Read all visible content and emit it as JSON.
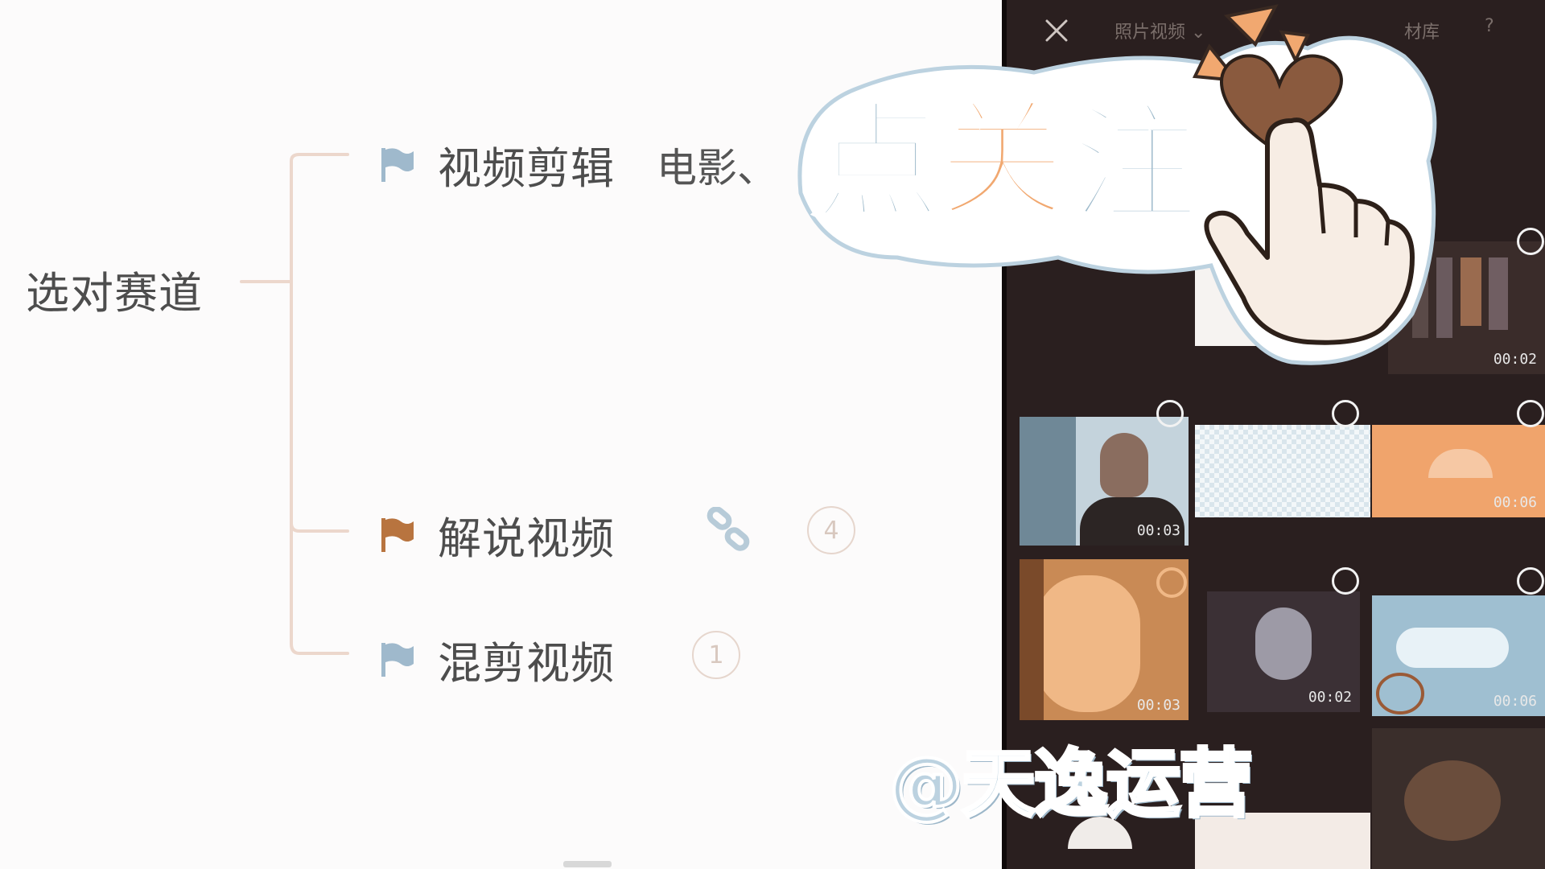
{
  "mindmap": {
    "root": "选对赛道",
    "branches": [
      {
        "label": "视频剪辑",
        "note": "电影、",
        "flag_color": "#9fb9cc"
      },
      {
        "label": "解说视频",
        "badge": "4",
        "flag_color": "#b8743f"
      },
      {
        "label": "混剪视频",
        "badge": "1",
        "flag_color": "#9fb9cc"
      }
    ]
  },
  "panel": {
    "dropdown_label": "照片视频",
    "library_label": "材库",
    "help_label": "?",
    "durations": [
      "00:02",
      "00:03",
      "00:06",
      "00:03",
      "00:02",
      "00:06"
    ]
  },
  "overlay": {
    "sticker_text_1": "点",
    "sticker_text_2": "关",
    "sticker_text_3": "注",
    "watermark": "@天逸运营"
  },
  "colors": {
    "sticker_blue": "#9ebacb",
    "sticker_orange": "#f1a870",
    "heart_brown": "#8a5a3e",
    "panel_bg": "#2a1f1f"
  },
  "icons": {
    "link": "link-icon",
    "close": "close-icon",
    "flag": "flag-icon",
    "heart": "heart-icon",
    "hand": "pointing-hand-icon"
  }
}
